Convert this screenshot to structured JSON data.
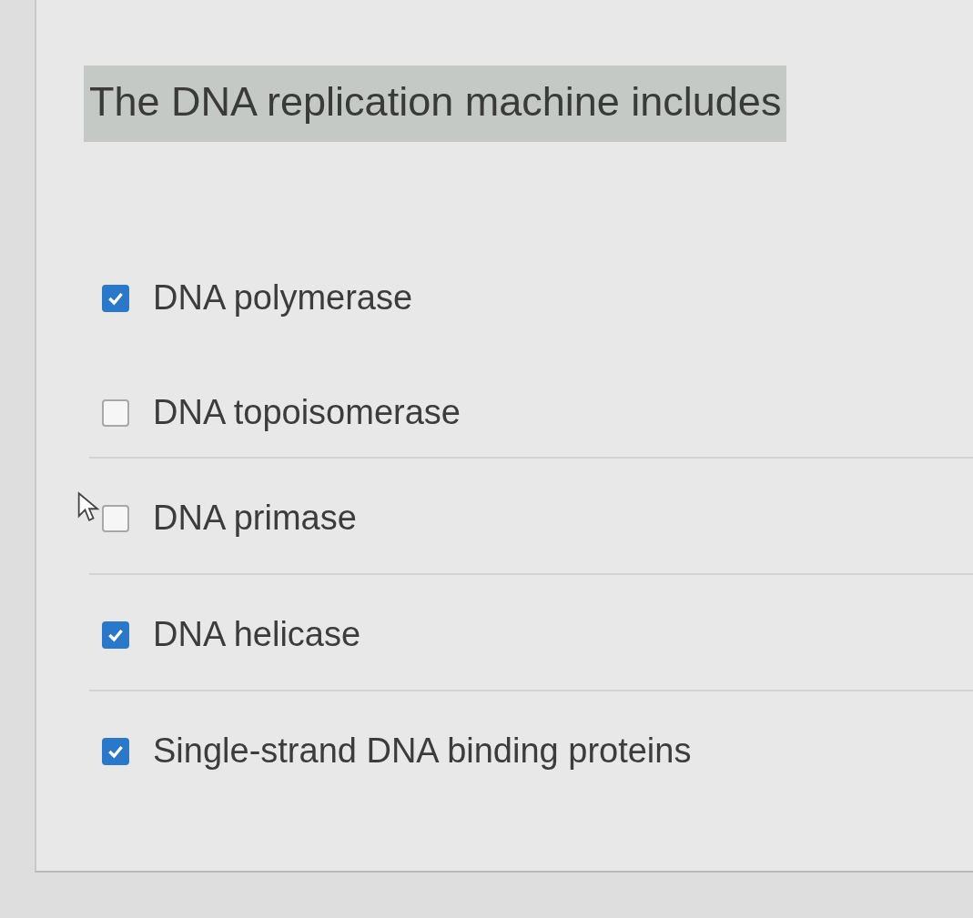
{
  "question": "The DNA replication machine includes",
  "options": [
    {
      "label": "DNA polymerase",
      "checked": true
    },
    {
      "label": "DNA topoisomerase",
      "checked": false
    },
    {
      "label": "DNA primase",
      "checked": false
    },
    {
      "label": "DNA helicase",
      "checked": true
    },
    {
      "label": "Single-strand DNA binding proteins",
      "checked": true
    }
  ]
}
